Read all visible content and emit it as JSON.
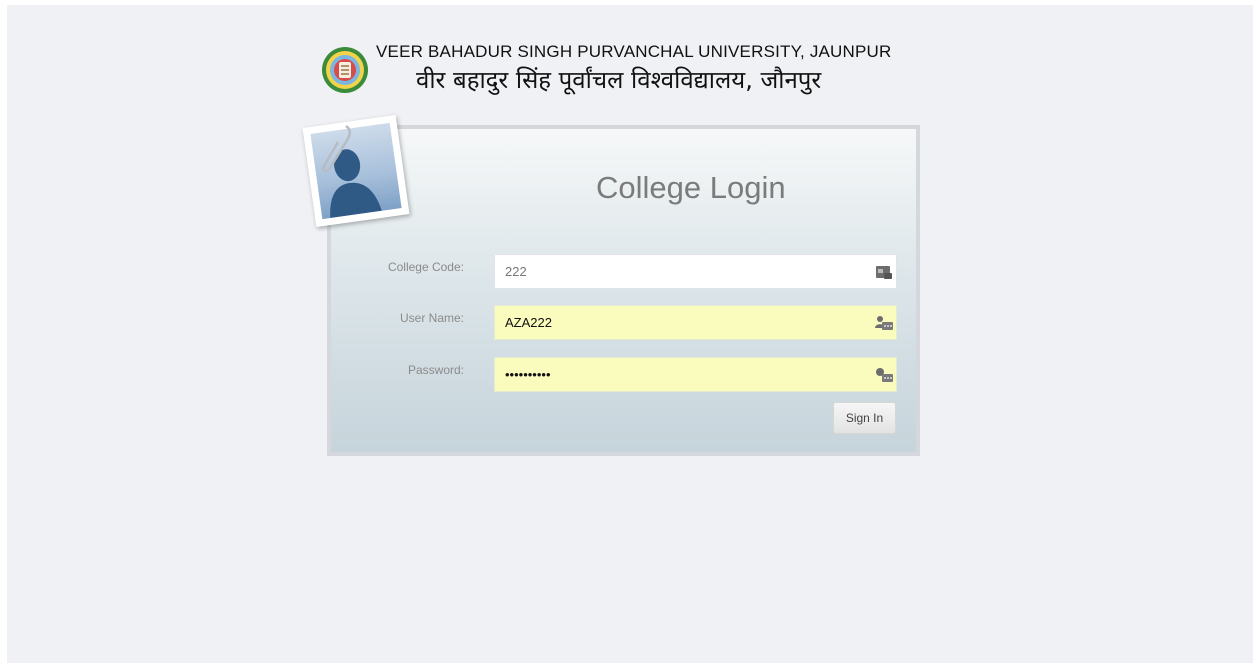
{
  "header": {
    "title_en": "VEER BAHADUR SINGH PURVANCHAL UNIVERSITY, JAUNPUR",
    "title_hi": "वीर बहादुर सिंह पूर्वांचल विश्वविद्यालय, जौनपुर",
    "logo_icon": "university-seal-icon"
  },
  "login": {
    "title": "College Login",
    "college_code_label": "College Code:",
    "college_code_value": "222",
    "username_label": "User Name:",
    "username_value": "AZA222",
    "password_label": "Password:",
    "password_value": "••••••••••",
    "signin_label": "Sign In",
    "icons": {
      "college_code": "id-card-icon",
      "username": "user-card-icon",
      "password": "key-card-icon",
      "profile": "user-silhouette-icon"
    }
  },
  "colors": {
    "page_background": "#f0f1f4",
    "autofill_background": "#fafcbe",
    "title_gray": "#7b7b7b"
  }
}
